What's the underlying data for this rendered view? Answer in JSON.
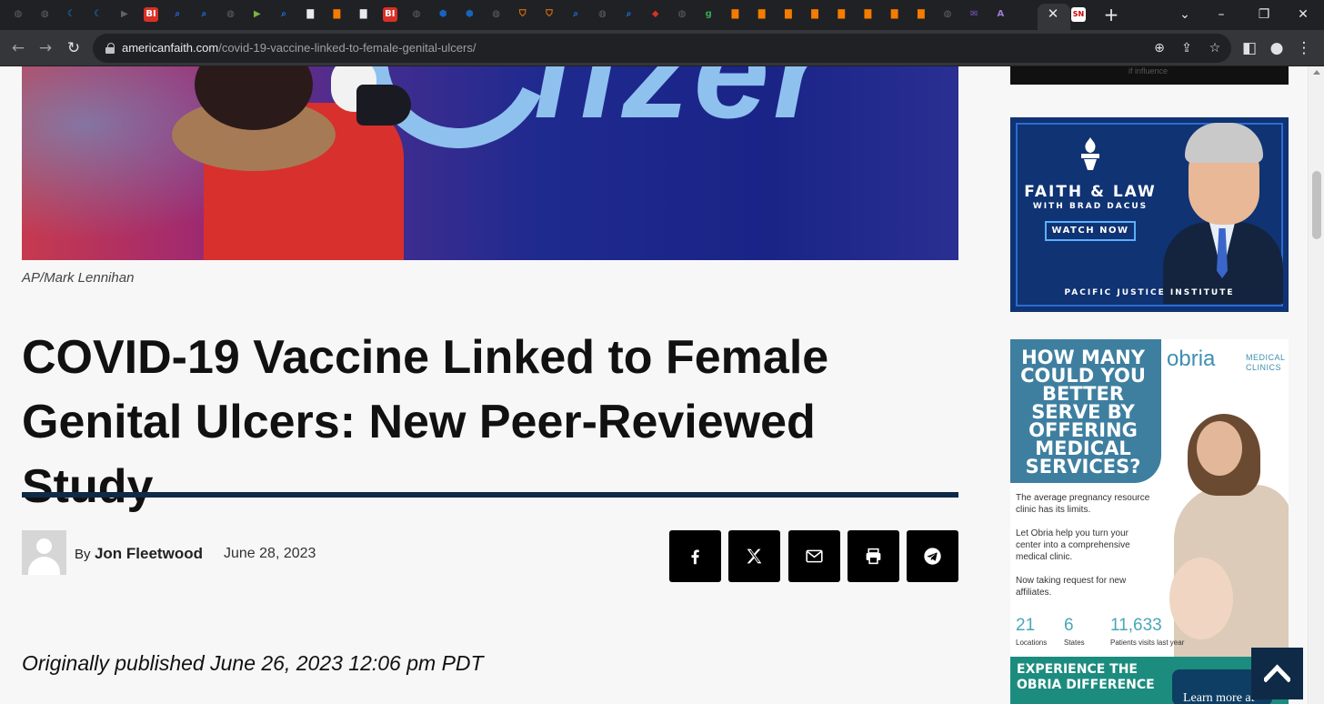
{
  "browser": {
    "url_host": "americanfaith.com",
    "url_path": "/covid-19-vaccine-linked-to-female-genital-ulcers/",
    "active_tab_favicon": "SN",
    "favicons": [
      {
        "icon": "globe-icon",
        "color": "#5f6368",
        "glyph": "◍"
      },
      {
        "icon": "globe-icon",
        "color": "#5f6368",
        "glyph": "◍"
      },
      {
        "icon": "c-icon",
        "color": "#1e88e5",
        "glyph": "☾"
      },
      {
        "icon": "c-icon",
        "color": "#1e88e5",
        "glyph": "☾"
      },
      {
        "icon": "arrow-icon",
        "color": "#5f6368",
        "glyph": "▶"
      },
      {
        "icon": "bi-icon",
        "color": "#d93025",
        "glyph": "BI"
      },
      {
        "icon": "search-icon",
        "color": "#1a73e8",
        "glyph": "⌕"
      },
      {
        "icon": "search-icon",
        "color": "#1a73e8",
        "glyph": "⌕"
      },
      {
        "icon": "globe-icon",
        "color": "#5f6368",
        "glyph": "◍"
      },
      {
        "icon": "play-icon",
        "color": "#7cb342",
        "glyph": "▶"
      },
      {
        "icon": "search-icon",
        "color": "#1a73e8",
        "glyph": "⌕"
      },
      {
        "icon": "bookmark-icon",
        "color": "#e8eaed",
        "glyph": "▇"
      },
      {
        "icon": "bookmark-icon",
        "color": "#f57c00",
        "glyph": "▇"
      },
      {
        "icon": "bookmark-icon",
        "color": "#e8eaed",
        "glyph": "▇"
      },
      {
        "icon": "bi-icon",
        "color": "#d93025",
        "glyph": "BI"
      },
      {
        "icon": "globe-icon",
        "color": "#5f6368",
        "glyph": "◍"
      },
      {
        "icon": "hex-icon",
        "color": "#1565c0",
        "glyph": "⬢"
      },
      {
        "icon": "hex-icon",
        "color": "#1565c0",
        "glyph": "⬢"
      },
      {
        "icon": "globe-icon",
        "color": "#5f6368",
        "glyph": "◍"
      },
      {
        "icon": "shield-icon",
        "color": "#f57c00",
        "glyph": "⛉"
      },
      {
        "icon": "shield-icon",
        "color": "#f57c00",
        "glyph": "⛉"
      },
      {
        "icon": "search-icon",
        "color": "#1a73e8",
        "glyph": "⌕"
      },
      {
        "icon": "globe-icon",
        "color": "#5f6368",
        "glyph": "◍"
      },
      {
        "icon": "search-icon",
        "color": "#1a73e8",
        "glyph": "⌕"
      },
      {
        "icon": "pin-icon",
        "color": "#d93025",
        "glyph": "⬥"
      },
      {
        "icon": "globe-icon",
        "color": "#5f6368",
        "glyph": "◍"
      },
      {
        "icon": "g-icon",
        "color": "#34a853",
        "glyph": "g"
      },
      {
        "icon": "bookmark-icon",
        "color": "#f57c00",
        "glyph": "▇"
      },
      {
        "icon": "bookmark-icon",
        "color": "#f57c00",
        "glyph": "▇"
      },
      {
        "icon": "bookmark-icon",
        "color": "#f57c00",
        "glyph": "▇"
      },
      {
        "icon": "bookmark-icon",
        "color": "#f57c00",
        "glyph": "▇"
      },
      {
        "icon": "bookmark-icon",
        "color": "#f57c00",
        "glyph": "▇"
      },
      {
        "icon": "bookmark-icon",
        "color": "#f57c00",
        "glyph": "▇"
      },
      {
        "icon": "bookmark-icon",
        "color": "#f57c00",
        "glyph": "▇"
      },
      {
        "icon": "bookmark-icon",
        "color": "#f57c00",
        "glyph": "▇"
      },
      {
        "icon": "globe-icon",
        "color": "#5f6368",
        "glyph": "◍"
      },
      {
        "icon": "mail-icon",
        "color": "#7e57c2",
        "glyph": "✉"
      },
      {
        "icon": "a-icon",
        "color": "#9c7bd6",
        "glyph": "A"
      }
    ]
  },
  "article": {
    "photo_credit": "AP/Mark Lennihan",
    "title": "COVID-19 Vaccine Linked to Female Genital Ulcers: New Peer-Reviewed Study",
    "by_prefix": "By",
    "author": "Jon Fleetwood",
    "date": "June 28, 2023",
    "originally_published": "Originally published June 26, 2023 12:06 pm PDT",
    "hero_logo_text": "fizer"
  },
  "share_buttons": [
    {
      "name": "share-facebook-button",
      "icon": "facebook-icon"
    },
    {
      "name": "share-x-button",
      "icon": "x-icon"
    },
    {
      "name": "share-email-button",
      "icon": "email-icon"
    },
    {
      "name": "share-print-button",
      "icon": "print-icon"
    },
    {
      "name": "share-telegram-button",
      "icon": "telegram-icon"
    }
  ],
  "ads": {
    "top_snippet": "if influence",
    "faith_law": {
      "title": "FAITH & LAW",
      "subtitle": "WITH BRAD DACUS",
      "cta": "WATCH NOW",
      "footer": "PACIFIC JUSTICE INSTITUTE"
    },
    "obria": {
      "question": "HOW MANY COULD YOU BETTER SERVE BY OFFERING MEDICAL SERVICES?",
      "brand": "obria",
      "brand_sub_1": "MEDICAL",
      "brand_sub_2": "CLINICS",
      "p1": "The average pregnancy resource clinic has its limits.",
      "p2": "Let Obria help you turn your center into a comprehensive medical clinic.",
      "p3": "Now taking request for new affiliates.",
      "stats": [
        {
          "value": "21",
          "label": "Locations"
        },
        {
          "value": "6",
          "label": "States"
        },
        {
          "value": "11,633",
          "label": "Patients visits last year"
        }
      ],
      "experience": "EXPERIENCE THE OBRIA DIFFERENCE",
      "cta": "Learn more at"
    }
  },
  "colors": {
    "rule": "#0f2a47",
    "back_to_top": "#0f2a47",
    "share_bg": "#000000"
  }
}
